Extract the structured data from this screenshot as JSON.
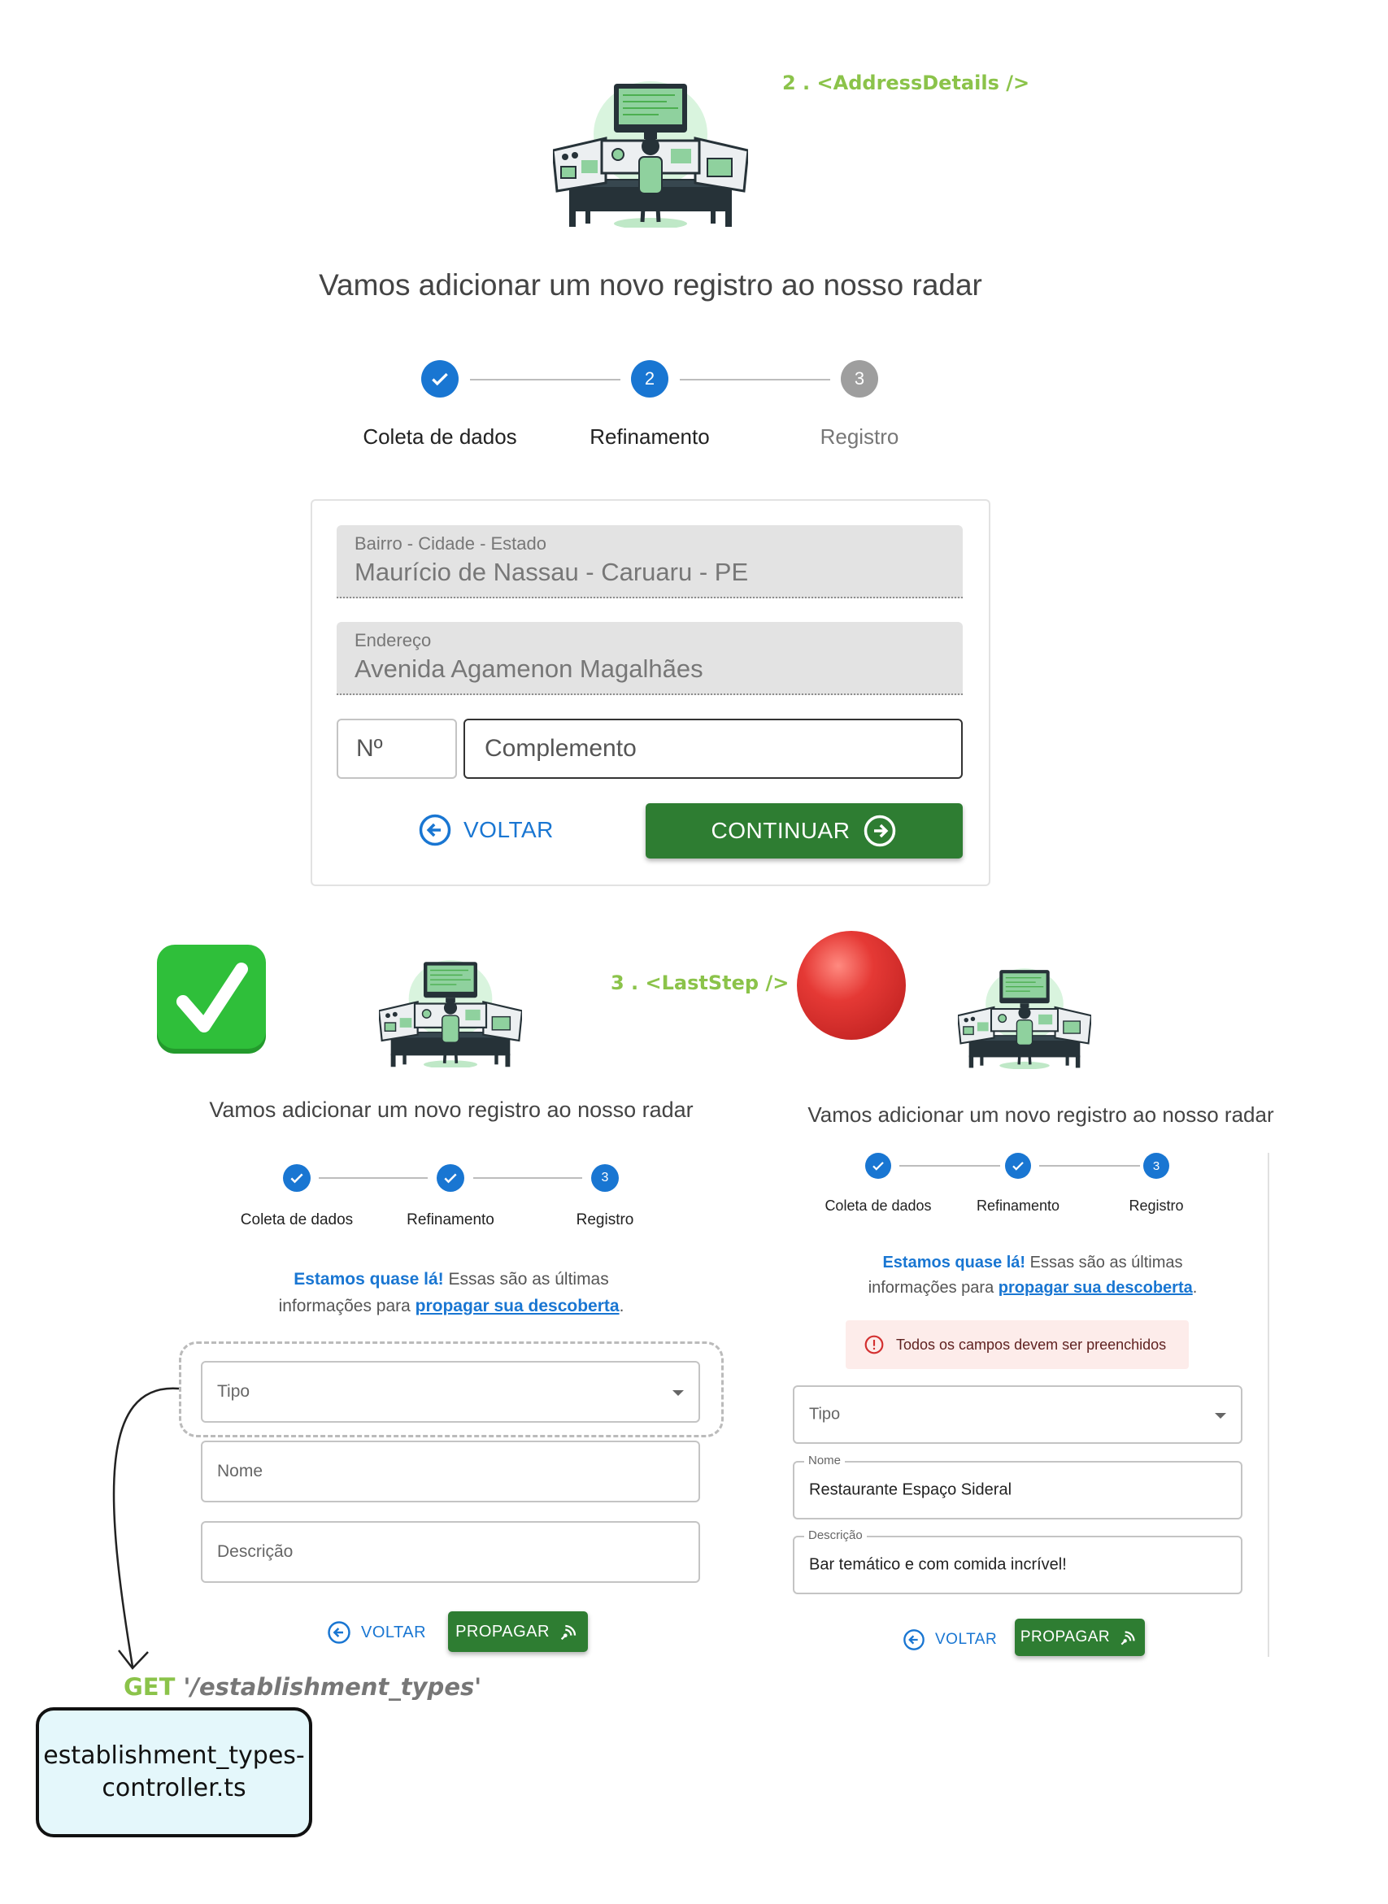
{
  "top": {
    "tag": "2 . <AddressDetails />",
    "title": "Vamos adicionar um novo registro ao nosso radar",
    "steps": [
      {
        "label": "Coleta de dados",
        "number": "1",
        "state": "done"
      },
      {
        "label": "Refinamento",
        "number": "2",
        "state": "active"
      },
      {
        "label": "Registro",
        "number": "3",
        "state": "pending"
      }
    ],
    "form": {
      "bairro_label": "Bairro - Cidade - Estado",
      "bairro_value": "Maurício de Nassau - Caruaru - PE",
      "endereco_label": "Endereço",
      "endereco_value": "Avenida Agamenon Magalhães",
      "numero_placeholder": "Nº",
      "complemento_placeholder": "Complemento",
      "back_label": "VOLTAR",
      "continue_label": "CONTINUAR"
    }
  },
  "last_step_tag": "3 . <LastStep />",
  "left": {
    "title": "Vamos adicionar um novo registro ao nosso radar",
    "steps": [
      {
        "label": "Coleta de dados",
        "number": "1",
        "state": "done"
      },
      {
        "label": "Refinamento",
        "number": "2",
        "state": "done"
      },
      {
        "label": "Registro",
        "number": "3",
        "state": "active"
      }
    ],
    "note": {
      "strong": "Estamos quase lá!",
      "text_1": " Essas são as últimas",
      "text_2": "informações para ",
      "link": "propagar sua descoberta",
      "end": "."
    },
    "tipo_placeholder": "Tipo",
    "nome_placeholder": "Nome",
    "descricao_placeholder": "Descrição",
    "back_label": "VOLTAR",
    "propagar_label": "PROPAGAR"
  },
  "right": {
    "title": "Vamos adicionar um novo registro ao nosso radar",
    "steps": [
      {
        "label": "Coleta de dados",
        "number": "1",
        "state": "done"
      },
      {
        "label": "Refinamento",
        "number": "2",
        "state": "done"
      },
      {
        "label": "Registro",
        "number": "3",
        "state": "active"
      }
    ],
    "note": {
      "strong": "Estamos quase lá!",
      "text_1": " Essas são as últimas",
      "text_2": "informações para ",
      "link": "propagar sua descoberta",
      "end": "."
    },
    "error": "Todos os campos devem ser preenchidos",
    "tipo_placeholder": "Tipo",
    "nome_label": "Nome",
    "nome_value": "Restaurante Espaço Sideral",
    "descricao_label": "Descrição",
    "descricao_value": "Bar temático e com comida incrível!",
    "back_label": "VOLTAR",
    "propagar_label": "PROPAGAR"
  },
  "annotation": {
    "method": "GET",
    "path": "'/establishment_types'",
    "controller_line1": "establishment_types-",
    "controller_line2": "controller.ts"
  },
  "icons": {
    "check_emoji": "white-check-mark-icon",
    "red_circle": "red-circle-icon",
    "illustration": "operator-console-illustration"
  },
  "colors": {
    "primary": "#1976d2",
    "green": "#2e7d32",
    "tag_green": "#8bc34a",
    "error_bg": "#fdecea",
    "error_text": "#b71c1c"
  }
}
